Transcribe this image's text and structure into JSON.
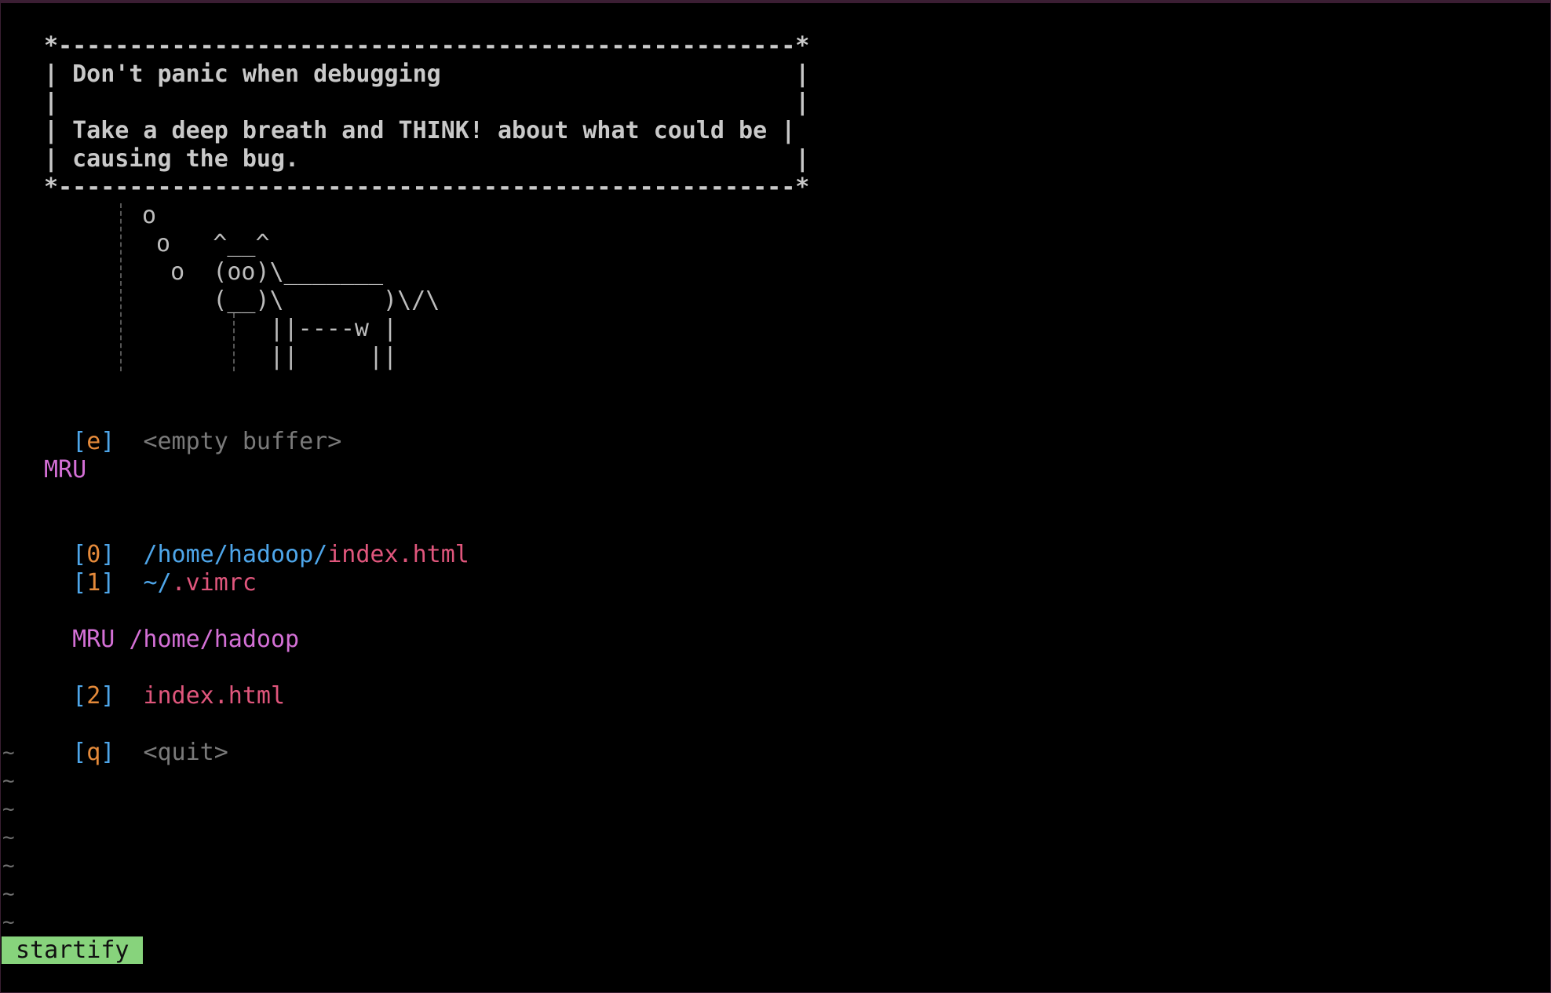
{
  "fortune_box": {
    "top": "*----------------------------------------------------*",
    "line1": "| Don't panic when debugging                         |",
    "line2": "|                                                    |",
    "line3": "| Take a deep breath and THINK! about what could be |",
    "line4": "| causing the bug.                                   |",
    "bottom": "*----------------------------------------------------*"
  },
  "cow": {
    "l1": "o",
    "l2": " o   ^__^",
    "l3": "  o  (oo)\\_______",
    "l4": "     (__)\\       )\\/\\",
    "l5": "         ||----w |",
    "l6": "         ||     ||"
  },
  "entries": {
    "empty": {
      "open": "[",
      "key": "e",
      "close": "]",
      "label": "<empty buffer>"
    },
    "mru_header": "MRU",
    "mru": [
      {
        "open": "[",
        "key": "0",
        "close": "]",
        "dir": "/home/hadoop/",
        "file": "index.html"
      },
      {
        "open": "[",
        "key": "1",
        "close": "]",
        "dir": "~/",
        "file": ".vimrc"
      }
    ],
    "mru_dir_header": "MRU",
    "mru_dir_path": "/home/hadoop",
    "mru_dir": [
      {
        "open": "[",
        "key": "2",
        "close": "]",
        "dir": "",
        "file": "index.html"
      }
    ],
    "quit": {
      "open": "[",
      "key": "q",
      "close": "]",
      "label": "<quit>"
    }
  },
  "tildes": [
    "~",
    "~",
    "~",
    "~",
    "~",
    "~",
    "~"
  ],
  "statusline": {
    "label": "startify"
  },
  "colors": {
    "background": "#000000",
    "bracket": "#4ea6ea",
    "key": "#e58a3a",
    "header": "#d470d6",
    "file": "#e0567c",
    "path": "#4ea6ea",
    "statusline_bg": "#87d37c"
  }
}
